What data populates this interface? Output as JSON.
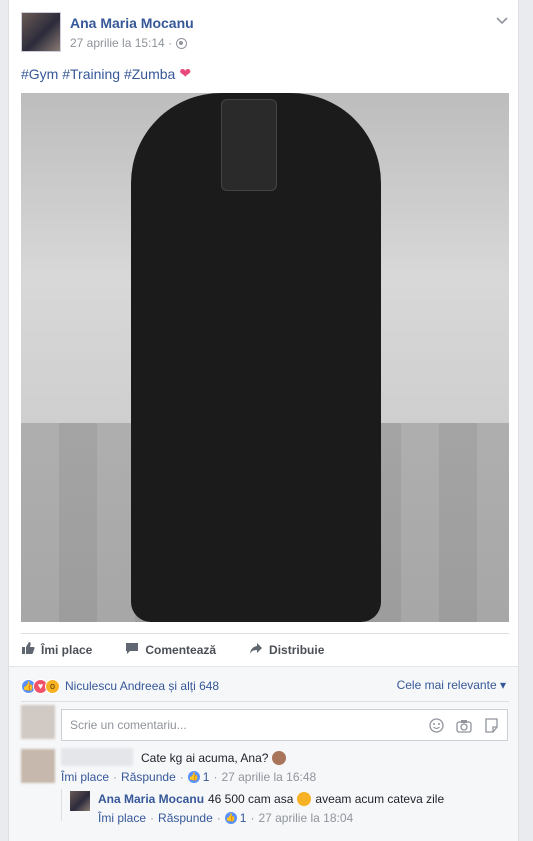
{
  "post": {
    "author": "Ana Maria Mocanu",
    "timestamp": "27 aprilie la 15:14 ·",
    "text": "#Gym #Training #Zumba",
    "privacy_icon": "globe-icon"
  },
  "actions": {
    "like": "Îmi place",
    "comment": "Comentează",
    "share": "Distribuie"
  },
  "reactions": {
    "names": "Niculescu Andreea și alți 648",
    "sort": "Cele mai relevante"
  },
  "comment_input": {
    "placeholder": "Scrie un comentariu..."
  },
  "comments": [
    {
      "text": "Cate kg ai acuma, Ana?",
      "like": "Îmi place",
      "reply": "Răspunde",
      "likes": "1",
      "date": "27 aprilie la 16:48"
    }
  ],
  "reply": {
    "author": "Ana Maria Mocanu",
    "text_before": "46 500 cam asa",
    "text_after": "aveam acum cateva zile",
    "like": "Îmi place",
    "reply": "Răspunde",
    "likes": "1",
    "date": "27 aprilie la 18:04"
  },
  "colors": {
    "link": "#365899",
    "like_blue": "#5890ff",
    "love_red": "#f25268"
  }
}
